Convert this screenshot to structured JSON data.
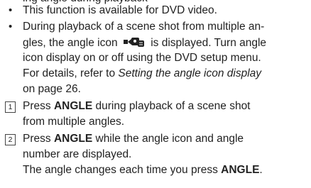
{
  "top_partial": "ing angle during playback",
  "bullets": [
    {
      "lines": [
        "This function is available for DVD video."
      ]
    },
    {
      "l1": "During playback of a scene shot from multiple an-",
      "l2a": "gles, the angle icon",
      "l2b": "is displayed. Turn angle",
      "l3": "icon display on or off using the DVD setup menu.",
      "l4": "For details, refer to ",
      "l4_ref": "Setting the angle icon display",
      "l5": "on page 26."
    }
  ],
  "steps": [
    {
      "number": "1",
      "l1a": "Press ",
      "l1_key": "ANGLE",
      "l1b": " during playback of a scene shot",
      "l2": "from multiple angles."
    },
    {
      "number": "2",
      "l1a": "Press ",
      "l1_key": "ANGLE",
      "l1b": " while the angle icon and angle",
      "l2": "number are displayed.",
      "l3a": "The angle changes each time you press ",
      "l3_key": "ANGLE",
      "l3b": "."
    }
  ],
  "icons": {
    "angle": "angle-camera-icon"
  }
}
